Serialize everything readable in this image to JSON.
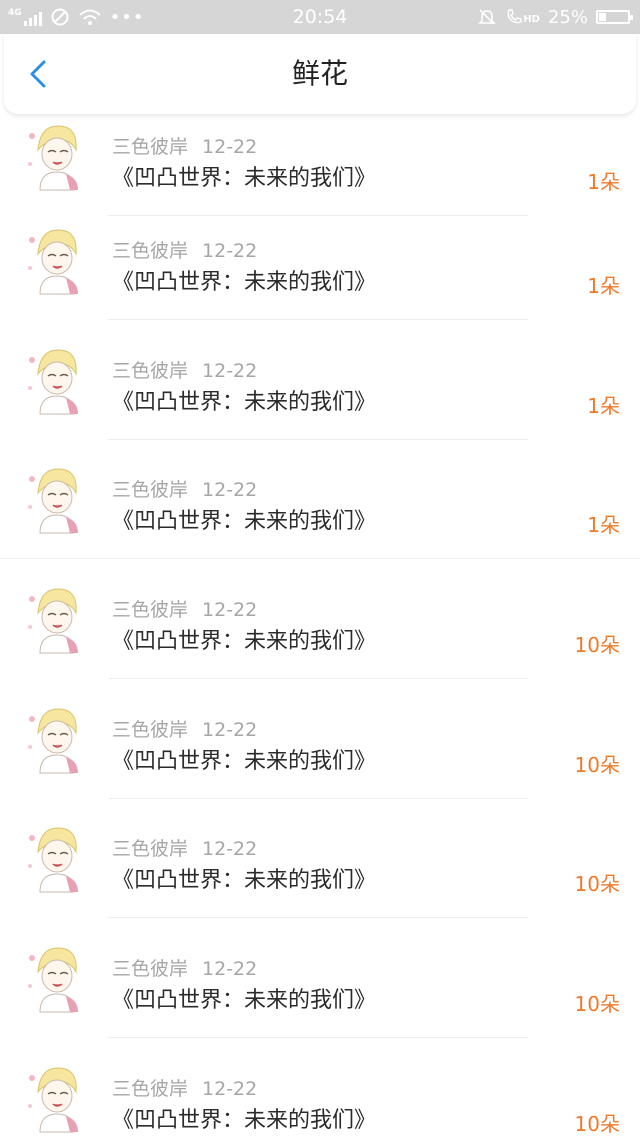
{
  "status_bar": {
    "network": "4G",
    "time": "20:54",
    "hd": "HD",
    "battery_percent": "25%",
    "battery_level": 0.25
  },
  "header": {
    "title": "鲜花"
  },
  "list": {
    "items": [
      {
        "user": "三色彼岸",
        "date": "12-22",
        "work": "《凹凸世界：未来的我们》",
        "amount": "1朵"
      },
      {
        "user": "三色彼岸",
        "date": "12-22",
        "work": "《凹凸世界：未来的我们》",
        "amount": "1朵"
      },
      {
        "user": "三色彼岸",
        "date": "12-22",
        "work": "《凹凸世界：未来的我们》",
        "amount": "1朵"
      },
      {
        "user": "三色彼岸",
        "date": "12-22",
        "work": "《凹凸世界：未来的我们》",
        "amount": "1朵"
      },
      {
        "user": "三色彼岸",
        "date": "12-22",
        "work": "《凹凸世界：未来的我们》",
        "amount": "10朵"
      },
      {
        "user": "三色彼岸",
        "date": "12-22",
        "work": "《凹凸世界：未来的我们》",
        "amount": "10朵"
      },
      {
        "user": "三色彼岸",
        "date": "12-22",
        "work": "《凹凸世界：未来的我们》",
        "amount": "10朵"
      },
      {
        "user": "三色彼岸",
        "date": "12-22",
        "work": "《凹凸世界：未来的我们》",
        "amount": "10朵"
      },
      {
        "user": "三色彼岸",
        "date": "12-22",
        "work": "《凹凸世界：未来的我们》",
        "amount": "10朵"
      }
    ]
  },
  "colors": {
    "accent": "#2a8fe6",
    "amount": "#f07a2a",
    "statusbar_bg": "#d6d6d6"
  }
}
